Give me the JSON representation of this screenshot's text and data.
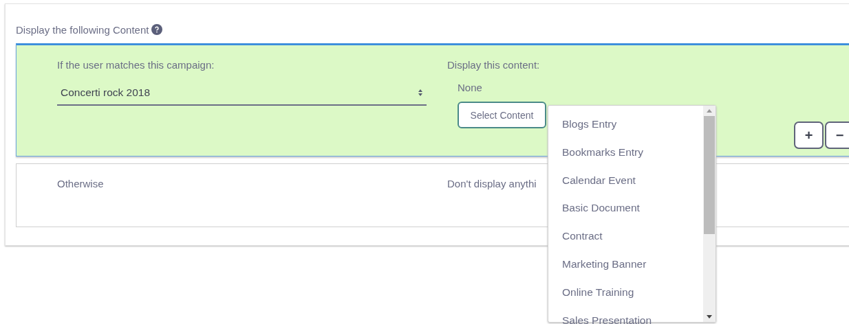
{
  "section": {
    "title": "Display the following Content"
  },
  "rule": {
    "campaign_label": "If the user matches this campaign:",
    "campaign_value": "Concerti rock 2018",
    "content_label": "Display this content:",
    "content_value": "None",
    "select_button": "Select Content",
    "add_button": "+",
    "remove_button": "−"
  },
  "otherwise": {
    "label": "Otherwise",
    "content": "Don't display anythi"
  },
  "dropdown": {
    "items": [
      {
        "label": "Blogs Entry"
      },
      {
        "label": "Bookmarks Entry"
      },
      {
        "label": "Calendar Event"
      },
      {
        "label": "Basic Document"
      },
      {
        "label": "Contract"
      },
      {
        "label": "Marketing Banner"
      },
      {
        "label": "Online Training"
      },
      {
        "label": "Sales Presentation"
      }
    ]
  }
}
